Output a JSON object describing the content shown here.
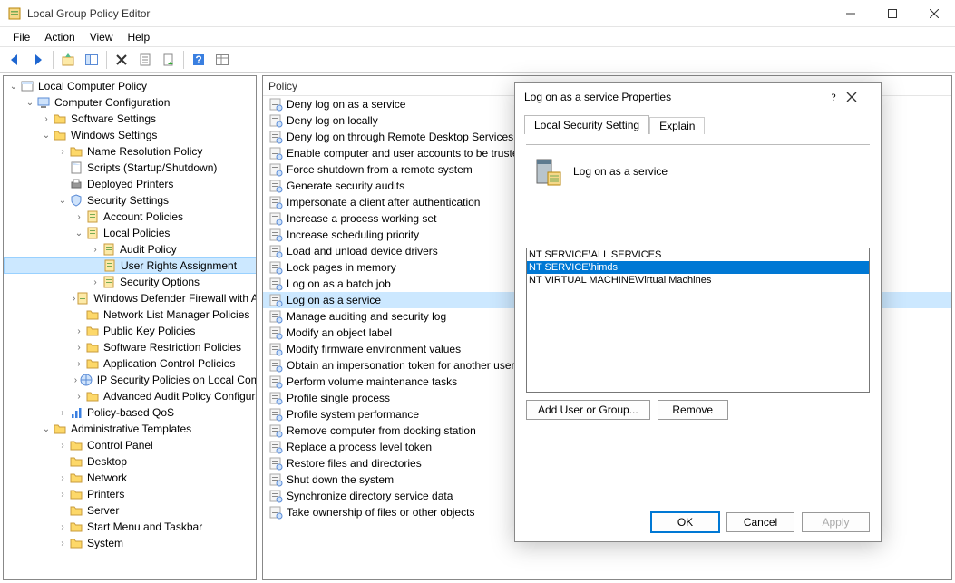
{
  "window": {
    "title": "Local Group Policy Editor"
  },
  "menubar": [
    "File",
    "Action",
    "View",
    "Help"
  ],
  "tree": {
    "root": "Local Computer Policy",
    "nodes": [
      {
        "depth": 0,
        "exp": "down",
        "icon": "root",
        "label": "Local Computer Policy"
      },
      {
        "depth": 1,
        "exp": "down",
        "icon": "computer",
        "label": "Computer Configuration"
      },
      {
        "depth": 2,
        "exp": "right",
        "icon": "folder",
        "label": "Software Settings"
      },
      {
        "depth": 2,
        "exp": "down",
        "icon": "folder",
        "label": "Windows Settings"
      },
      {
        "depth": 3,
        "exp": "right",
        "icon": "folder",
        "label": "Name Resolution Policy"
      },
      {
        "depth": 3,
        "exp": "none",
        "icon": "script",
        "label": "Scripts (Startup/Shutdown)"
      },
      {
        "depth": 3,
        "exp": "none",
        "icon": "printer",
        "label": "Deployed Printers"
      },
      {
        "depth": 3,
        "exp": "down",
        "icon": "security",
        "label": "Security Settings"
      },
      {
        "depth": 4,
        "exp": "right",
        "icon": "policy",
        "label": "Account Policies"
      },
      {
        "depth": 4,
        "exp": "down",
        "icon": "policy",
        "label": "Local Policies"
      },
      {
        "depth": 5,
        "exp": "right",
        "icon": "policy",
        "label": "Audit Policy"
      },
      {
        "depth": 5,
        "exp": "none",
        "icon": "policy",
        "label": "User Rights Assignment",
        "selected": true
      },
      {
        "depth": 5,
        "exp": "right",
        "icon": "policy",
        "label": "Security Options"
      },
      {
        "depth": 4,
        "exp": "right",
        "icon": "policy",
        "label": "Windows Defender Firewall with Advanced Security"
      },
      {
        "depth": 4,
        "exp": "none",
        "icon": "folder",
        "label": "Network List Manager Policies"
      },
      {
        "depth": 4,
        "exp": "right",
        "icon": "folder",
        "label": "Public Key Policies"
      },
      {
        "depth": 4,
        "exp": "right",
        "icon": "folder",
        "label": "Software Restriction Policies"
      },
      {
        "depth": 4,
        "exp": "right",
        "icon": "folder",
        "label": "Application Control Policies"
      },
      {
        "depth": 4,
        "exp": "right",
        "icon": "ipsec",
        "label": "IP Security Policies on Local Computer"
      },
      {
        "depth": 4,
        "exp": "right",
        "icon": "folder",
        "label": "Advanced Audit Policy Configuration"
      },
      {
        "depth": 3,
        "exp": "right",
        "icon": "qos",
        "label": "Policy-based QoS"
      },
      {
        "depth": 2,
        "exp": "down",
        "icon": "folder",
        "label": "Administrative Templates"
      },
      {
        "depth": 3,
        "exp": "right",
        "icon": "folder",
        "label": "Control Panel"
      },
      {
        "depth": 3,
        "exp": "none",
        "icon": "folder",
        "label": "Desktop"
      },
      {
        "depth": 3,
        "exp": "right",
        "icon": "folder",
        "label": "Network"
      },
      {
        "depth": 3,
        "exp": "right",
        "icon": "folder",
        "label": "Printers"
      },
      {
        "depth": 3,
        "exp": "none",
        "icon": "folder",
        "label": "Server"
      },
      {
        "depth": 3,
        "exp": "right",
        "icon": "folder",
        "label": "Start Menu and Taskbar"
      },
      {
        "depth": 3,
        "exp": "right",
        "icon": "folder",
        "label": "System"
      }
    ]
  },
  "list": {
    "header": "Policy",
    "items": [
      "Deny log on as a service",
      "Deny log on locally",
      "Deny log on through Remote Desktop Services",
      "Enable computer and user accounts to be trusted for delegation",
      "Force shutdown from a remote system",
      "Generate security audits",
      "Impersonate a client after authentication",
      "Increase a process working set",
      "Increase scheduling priority",
      "Load and unload device drivers",
      "Lock pages in memory",
      "Log on as a batch job",
      "Log on as a service",
      "Manage auditing and security log",
      "Modify an object label",
      "Modify firmware environment values",
      "Obtain an impersonation token for another user in the same session",
      "Perform volume maintenance tasks",
      "Profile single process",
      "Profile system performance",
      "Remove computer from docking station",
      "Replace a process level token",
      "Restore files and directories",
      "Shut down the system",
      "Synchronize directory service data",
      "Take ownership of files or other objects"
    ],
    "selected_index": 12
  },
  "dialog": {
    "title": "Log on as a service Properties",
    "tabs": [
      "Local Security Setting",
      "Explain"
    ],
    "active_tab": 0,
    "heading": "Log on as a service",
    "accounts": [
      "NT SERVICE\\ALL SERVICES",
      "NT SERVICE\\himds",
      "NT VIRTUAL MACHINE\\Virtual Machines"
    ],
    "selected_account_index": 1,
    "buttons": {
      "add": "Add User or Group...",
      "remove": "Remove",
      "ok": "OK",
      "cancel": "Cancel",
      "apply": "Apply"
    }
  }
}
